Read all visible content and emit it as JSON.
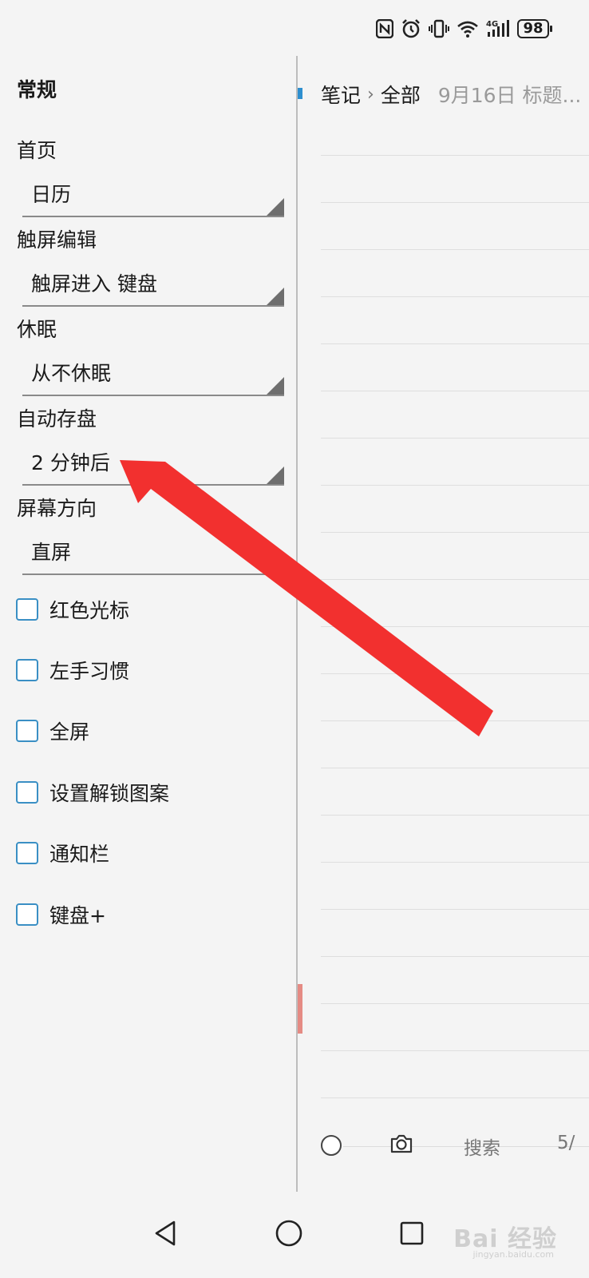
{
  "status_bar": {
    "battery": "98",
    "icons": [
      "nfc-icon",
      "alarm-icon",
      "vibrate-icon",
      "wifi-icon",
      "signal-4g-icon",
      "battery-icon"
    ]
  },
  "settings": {
    "section_title": "常规",
    "home": {
      "label": "首页",
      "value": "日历"
    },
    "touch_edit": {
      "label": "触屏编辑",
      "value": "触屏进入 键盘"
    },
    "sleep": {
      "label": "休眠",
      "value": "从不休眠"
    },
    "autosave": {
      "label": "自动存盘",
      "value": "2 分钟后"
    },
    "orientation": {
      "label": "屏幕方向",
      "value": "直屏"
    },
    "checkboxes": [
      {
        "label": "红色光标",
        "checked": false
      },
      {
        "label": "左手习惯",
        "checked": false
      },
      {
        "label": "全屏",
        "checked": false
      },
      {
        "label": "设置解锁图案",
        "checked": false
      },
      {
        "label": "通知栏",
        "checked": false
      },
      {
        "label": "键盘+",
        "checked": false
      }
    ]
  },
  "notes": {
    "breadcrumb_root": "笔记",
    "breadcrumb_current": "全部",
    "breadcrumb_meta": "9月16日 标题...",
    "toolbar": {
      "search_label": "搜索",
      "page_label": "5/"
    }
  },
  "watermark": {
    "text": "Bai 经验",
    "sub": "jingyan.baidu.com"
  },
  "colors": {
    "checkbox_border": "#3a8fc4",
    "annotation_arrow": "#f2302f",
    "marker_blue": "#2e8fcf",
    "marker_red": "#e58b84"
  }
}
